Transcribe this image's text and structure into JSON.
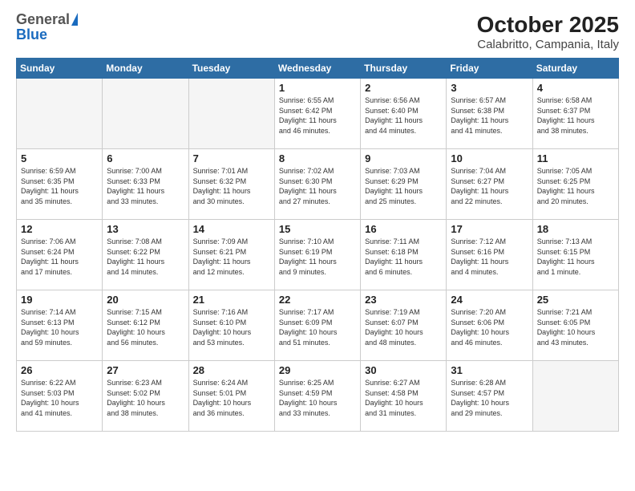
{
  "header": {
    "logo_general": "General",
    "logo_blue": "Blue",
    "month": "October 2025",
    "location": "Calabritto, Campania, Italy"
  },
  "days_of_week": [
    "Sunday",
    "Monday",
    "Tuesday",
    "Wednesday",
    "Thursday",
    "Friday",
    "Saturday"
  ],
  "weeks": [
    [
      {
        "day": "",
        "info": ""
      },
      {
        "day": "",
        "info": ""
      },
      {
        "day": "",
        "info": ""
      },
      {
        "day": "1",
        "info": "Sunrise: 6:55 AM\nSunset: 6:42 PM\nDaylight: 11 hours\nand 46 minutes."
      },
      {
        "day": "2",
        "info": "Sunrise: 6:56 AM\nSunset: 6:40 PM\nDaylight: 11 hours\nand 44 minutes."
      },
      {
        "day": "3",
        "info": "Sunrise: 6:57 AM\nSunset: 6:38 PM\nDaylight: 11 hours\nand 41 minutes."
      },
      {
        "day": "4",
        "info": "Sunrise: 6:58 AM\nSunset: 6:37 PM\nDaylight: 11 hours\nand 38 minutes."
      }
    ],
    [
      {
        "day": "5",
        "info": "Sunrise: 6:59 AM\nSunset: 6:35 PM\nDaylight: 11 hours\nand 35 minutes."
      },
      {
        "day": "6",
        "info": "Sunrise: 7:00 AM\nSunset: 6:33 PM\nDaylight: 11 hours\nand 33 minutes."
      },
      {
        "day": "7",
        "info": "Sunrise: 7:01 AM\nSunset: 6:32 PM\nDaylight: 11 hours\nand 30 minutes."
      },
      {
        "day": "8",
        "info": "Sunrise: 7:02 AM\nSunset: 6:30 PM\nDaylight: 11 hours\nand 27 minutes."
      },
      {
        "day": "9",
        "info": "Sunrise: 7:03 AM\nSunset: 6:29 PM\nDaylight: 11 hours\nand 25 minutes."
      },
      {
        "day": "10",
        "info": "Sunrise: 7:04 AM\nSunset: 6:27 PM\nDaylight: 11 hours\nand 22 minutes."
      },
      {
        "day": "11",
        "info": "Sunrise: 7:05 AM\nSunset: 6:25 PM\nDaylight: 11 hours\nand 20 minutes."
      }
    ],
    [
      {
        "day": "12",
        "info": "Sunrise: 7:06 AM\nSunset: 6:24 PM\nDaylight: 11 hours\nand 17 minutes."
      },
      {
        "day": "13",
        "info": "Sunrise: 7:08 AM\nSunset: 6:22 PM\nDaylight: 11 hours\nand 14 minutes."
      },
      {
        "day": "14",
        "info": "Sunrise: 7:09 AM\nSunset: 6:21 PM\nDaylight: 11 hours\nand 12 minutes."
      },
      {
        "day": "15",
        "info": "Sunrise: 7:10 AM\nSunset: 6:19 PM\nDaylight: 11 hours\nand 9 minutes."
      },
      {
        "day": "16",
        "info": "Sunrise: 7:11 AM\nSunset: 6:18 PM\nDaylight: 11 hours\nand 6 minutes."
      },
      {
        "day": "17",
        "info": "Sunrise: 7:12 AM\nSunset: 6:16 PM\nDaylight: 11 hours\nand 4 minutes."
      },
      {
        "day": "18",
        "info": "Sunrise: 7:13 AM\nSunset: 6:15 PM\nDaylight: 11 hours\nand 1 minute."
      }
    ],
    [
      {
        "day": "19",
        "info": "Sunrise: 7:14 AM\nSunset: 6:13 PM\nDaylight: 10 hours\nand 59 minutes."
      },
      {
        "day": "20",
        "info": "Sunrise: 7:15 AM\nSunset: 6:12 PM\nDaylight: 10 hours\nand 56 minutes."
      },
      {
        "day": "21",
        "info": "Sunrise: 7:16 AM\nSunset: 6:10 PM\nDaylight: 10 hours\nand 53 minutes."
      },
      {
        "day": "22",
        "info": "Sunrise: 7:17 AM\nSunset: 6:09 PM\nDaylight: 10 hours\nand 51 minutes."
      },
      {
        "day": "23",
        "info": "Sunrise: 7:19 AM\nSunset: 6:07 PM\nDaylight: 10 hours\nand 48 minutes."
      },
      {
        "day": "24",
        "info": "Sunrise: 7:20 AM\nSunset: 6:06 PM\nDaylight: 10 hours\nand 46 minutes."
      },
      {
        "day": "25",
        "info": "Sunrise: 7:21 AM\nSunset: 6:05 PM\nDaylight: 10 hours\nand 43 minutes."
      }
    ],
    [
      {
        "day": "26",
        "info": "Sunrise: 6:22 AM\nSunset: 5:03 PM\nDaylight: 10 hours\nand 41 minutes."
      },
      {
        "day": "27",
        "info": "Sunrise: 6:23 AM\nSunset: 5:02 PM\nDaylight: 10 hours\nand 38 minutes."
      },
      {
        "day": "28",
        "info": "Sunrise: 6:24 AM\nSunset: 5:01 PM\nDaylight: 10 hours\nand 36 minutes."
      },
      {
        "day": "29",
        "info": "Sunrise: 6:25 AM\nSunset: 4:59 PM\nDaylight: 10 hours\nand 33 minutes."
      },
      {
        "day": "30",
        "info": "Sunrise: 6:27 AM\nSunset: 4:58 PM\nDaylight: 10 hours\nand 31 minutes."
      },
      {
        "day": "31",
        "info": "Sunrise: 6:28 AM\nSunset: 4:57 PM\nDaylight: 10 hours\nand 29 minutes."
      },
      {
        "day": "",
        "info": ""
      }
    ]
  ]
}
